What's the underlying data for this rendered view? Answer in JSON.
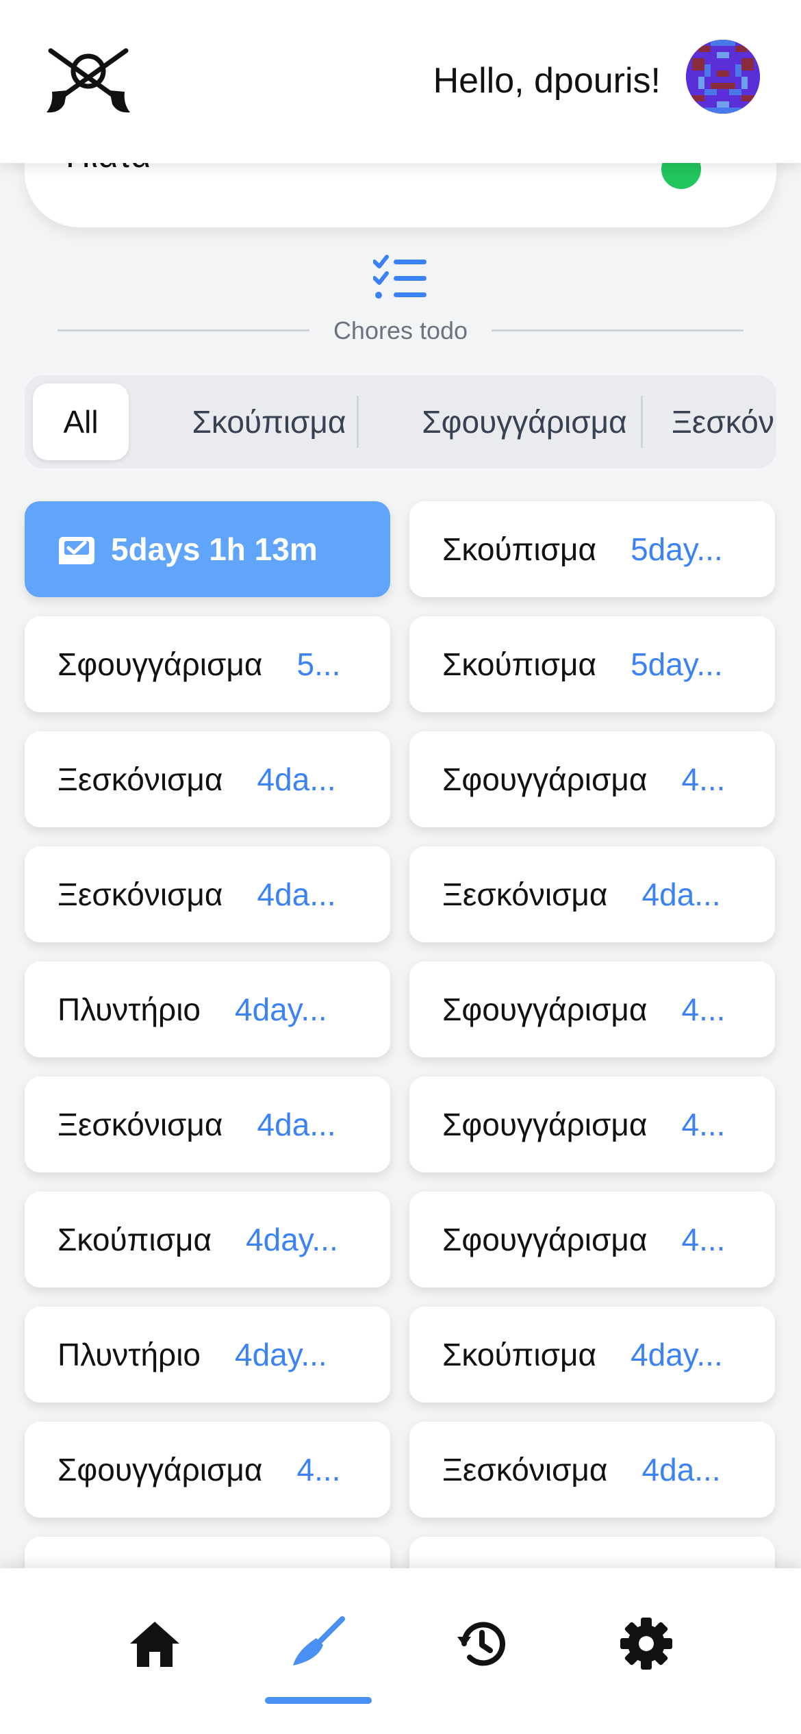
{
  "header": {
    "greeting": "Hello, dpouris!"
  },
  "previous_card": {
    "label": "Πιάτα"
  },
  "section": {
    "title": "Chores todo"
  },
  "tabs": [
    {
      "label": "All",
      "active": true
    },
    {
      "label": "Σκούπισμα",
      "active": false
    },
    {
      "label": "Σφουγγάρισμα",
      "active": false
    },
    {
      "label": "Ξεσκόν",
      "active": false
    }
  ],
  "chores": [
    {
      "name": "",
      "time": "5days 1h 13m",
      "highlight": true
    },
    {
      "name": "Σκούπισμα",
      "time": "5day..."
    },
    {
      "name": "Σφουγγάρισμα",
      "time": "5..."
    },
    {
      "name": "Σκούπισμα",
      "time": "5day..."
    },
    {
      "name": "Ξεσκόνισμα",
      "time": "4da..."
    },
    {
      "name": "Σφουγγάρισμα",
      "time": "4..."
    },
    {
      "name": "Ξεσκόνισμα",
      "time": "4da..."
    },
    {
      "name": "Ξεσκόνισμα",
      "time": "4da..."
    },
    {
      "name": "Πλυντήριο",
      "time": "4day..."
    },
    {
      "name": "Σφουγγάρισμα",
      "time": "4..."
    },
    {
      "name": "Ξεσκόνισμα",
      "time": "4da..."
    },
    {
      "name": "Σφουγγάρισμα",
      "time": "4..."
    },
    {
      "name": "Σκούπισμα",
      "time": "4day..."
    },
    {
      "name": "Σφουγγάρισμα",
      "time": "4..."
    },
    {
      "name": "Πλυντήριο",
      "time": "4day..."
    },
    {
      "name": "Σκούπισμα",
      "time": "4day..."
    },
    {
      "name": "Σφουγγάρισμα",
      "time": "4..."
    },
    {
      "name": "Ξεσκόνισμα",
      "time": "4da..."
    }
  ],
  "colors": {
    "accent": "#3b82f6",
    "highlight_card": "#60a5fa",
    "done_dot": "#22c55e"
  },
  "nav": [
    {
      "icon": "home-icon"
    },
    {
      "icon": "broom-icon",
      "active": true
    },
    {
      "icon": "history-icon"
    },
    {
      "icon": "gear-icon"
    }
  ]
}
